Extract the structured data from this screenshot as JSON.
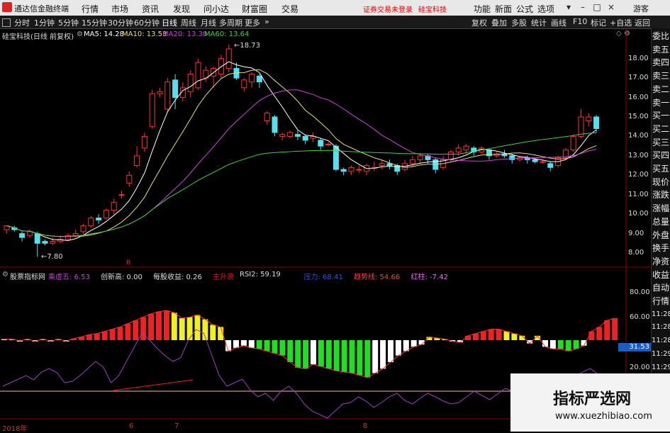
{
  "app": {
    "title": "通达信金融终端",
    "login_notice": "证券交易未登录",
    "stock_link": "硅宝科技"
  },
  "menu": [
    "行情",
    "市场",
    "资讯",
    "发现",
    "问小达",
    "财富圈",
    "交易"
  ],
  "menu_right": [
    "功能",
    "新面",
    "公式",
    "选项"
  ],
  "window_controls": {
    "guest": "游客"
  },
  "period_tabs": [
    "分时",
    "1分钟",
    "5分钟",
    "15分钟",
    "30分钟",
    "60分钟",
    "日线",
    "周线",
    "月线",
    "多周期",
    "更多"
  ],
  "active_tab": "日线",
  "toolbar_right": [
    "复权",
    "叠加",
    "多股",
    "统计",
    "画线",
    "F10",
    "标记",
    "+自选",
    "返回"
  ],
  "price_info": {
    "name": "硅宝科技(日线 前复权)",
    "ma5": "MA5: 14.28",
    "ma10": "MA10: 13.53",
    "ma20": "MA20: 13.30",
    "ma60": "MA60: 13.64",
    "high_label": "18.73",
    "low_label": "7.80",
    "b_mark": "B"
  },
  "y_ticks": [
    "18.00",
    "17.00",
    "16.00",
    "15.00",
    "14.00",
    "13.00",
    "12.00",
    "11.00",
    "10.00",
    "9.00",
    "8.00"
  ],
  "indicator": {
    "name": "股票指标网",
    "items": [
      {
        "label": "乘虚五:",
        "value": "6.53",
        "color": "#d03be0"
      },
      {
        "label": "创新高:",
        "value": "0.00",
        "color": "#dddddd"
      },
      {
        "label": "每股收益:",
        "value": "0.26",
        "color": "#dddddd"
      },
      {
        "label": "主升浪",
        "value": "",
        "color": "#e02020"
      },
      {
        "label": "RSI2:",
        "value": "59.19",
        "color": "#dddddd"
      },
      {
        "label": "压力:",
        "value": "68.41",
        "color": "#3050ff"
      },
      {
        "label": "趋势线:",
        "value": "54.66",
        "color": "#ff4040"
      },
      {
        "label": "红柱:",
        "value": "-7.42",
        "color": "#ff60ff"
      }
    ],
    "ticks": [
      "80.00",
      "60.00",
      "20.00"
    ],
    "current_value": "31.53"
  },
  "right_panel": [
    "委比",
    "卖五",
    "卖四",
    "卖三",
    "卖二",
    "卖一",
    "买一",
    "买二",
    "买三",
    "买四",
    "买五",
    "现价",
    "涨跌",
    "涨幅",
    "总量",
    "外盘",
    "换手",
    "净资",
    "收益",
    "自动",
    "行情",
    "11:28",
    "11:28",
    "11:28",
    "11:29",
    "11:29",
    "11:29",
    "11:29",
    "11:29"
  ],
  "x_labels": [
    "2018年",
    "6",
    "7",
    "8"
  ],
  "watermark": {
    "line1": "指标严选网",
    "line2": "www.xuezhibiao.com"
  },
  "chart_data": {
    "type": "candlestick",
    "series_ma": [
      "MA5",
      "MA10",
      "MA20",
      "MA60"
    ],
    "candles": [
      [
        9.2,
        9.4,
        9.0,
        9.3
      ],
      [
        9.3,
        9.2,
        9.1,
        9.4
      ],
      [
        9.0,
        8.8,
        8.6,
        9.1
      ],
      [
        8.9,
        9.1,
        8.8,
        9.2
      ],
      [
        9.0,
        8.5,
        7.8,
        9.1
      ],
      [
        8.6,
        8.5,
        8.4,
        8.7
      ],
      [
        8.5,
        8.6,
        8.4,
        8.8
      ],
      [
        8.6,
        8.7,
        8.5,
        8.9
      ],
      [
        8.7,
        8.9,
        8.6,
        9.0
      ],
      [
        8.9,
        9.0,
        8.8,
        9.2
      ],
      [
        9.1,
        9.4,
        9.0,
        9.5
      ],
      [
        9.4,
        9.8,
        9.3,
        9.9
      ],
      [
        9.8,
        9.7,
        9.5,
        10.0
      ],
      [
        9.8,
        10.2,
        9.7,
        10.3
      ],
      [
        10.2,
        10.6,
        10.0,
        10.8
      ],
      [
        11.0,
        11.0,
        10.8,
        11.2
      ],
      [
        11.6,
        12.0,
        11.4,
        12.2
      ],
      [
        12.5,
        13.0,
        12.4,
        13.5
      ],
      [
        13.4,
        14.0,
        13.2,
        14.2
      ],
      [
        14.5,
        16.2,
        14.4,
        16.4
      ],
      [
        16.2,
        16.3,
        16.0,
        16.5
      ],
      [
        15.4,
        16.8,
        15.2,
        17.0
      ],
      [
        16.9,
        16.0,
        15.4,
        17.2
      ],
      [
        16.0,
        16.5,
        15.8,
        16.8
      ],
      [
        16.3,
        17.2,
        16.0,
        17.4
      ],
      [
        16.5,
        17.8,
        16.4,
        18.0
      ],
      [
        17.0,
        17.4,
        16.8,
        17.6
      ],
      [
        17.1,
        17.5,
        16.5,
        17.6
      ],
      [
        17.2,
        18.0,
        17.0,
        18.2
      ],
      [
        17.5,
        18.5,
        17.3,
        18.73
      ],
      [
        17.5,
        17.0,
        16.9,
        17.8
      ],
      [
        16.5,
        16.9,
        16.3,
        17.0
      ],
      [
        16.8,
        17.2,
        16.5,
        17.3
      ],
      [
        17.1,
        16.8,
        16.5,
        17.2
      ],
      [
        14.8,
        15.2,
        14.6,
        15.3
      ],
      [
        15.0,
        14.2,
        14.0,
        15.1
      ],
      [
        14.0,
        14.1,
        13.8,
        14.2
      ],
      [
        14.0,
        14.2,
        13.9,
        14.3
      ],
      [
        14.1,
        14.0,
        13.8,
        14.3
      ],
      [
        14.0,
        13.8,
        13.6,
        14.1
      ],
      [
        13.9,
        14.0,
        13.7,
        14.2
      ],
      [
        13.8,
        13.5,
        13.3,
        13.9
      ],
      [
        13.6,
        13.6,
        13.5,
        13.7
      ],
      [
        13.5,
        12.3,
        12.2,
        13.6
      ],
      [
        12.3,
        12.2,
        12.0,
        12.4
      ],
      [
        12.2,
        12.4,
        12.0,
        12.5
      ],
      [
        12.3,
        12.3,
        12.1,
        12.5
      ],
      [
        12.2,
        12.5,
        12.0,
        12.6
      ],
      [
        12.4,
        12.4,
        12.2,
        12.7
      ],
      [
        12.5,
        12.6,
        12.3,
        12.8
      ],
      [
        12.6,
        12.5,
        12.3,
        12.8
      ],
      [
        12.5,
        12.2,
        12.0,
        12.6
      ],
      [
        12.3,
        12.6,
        12.2,
        12.8
      ],
      [
        12.6,
        12.8,
        12.4,
        13.0
      ],
      [
        12.8,
        13.0,
        12.6,
        13.1
      ],
      [
        13.0,
        12.8,
        12.6,
        13.1
      ],
      [
        12.8,
        12.3,
        12.1,
        12.9
      ],
      [
        12.4,
        12.8,
        12.3,
        13.0
      ],
      [
        12.8,
        13.2,
        12.7,
        13.3
      ],
      [
        13.2,
        13.4,
        13.0,
        13.6
      ],
      [
        13.3,
        13.5,
        13.1,
        13.6
      ],
      [
        13.4,
        13.2,
        13.0,
        13.5
      ],
      [
        13.2,
        13.4,
        13.1,
        13.5
      ],
      [
        13.3,
        13.0,
        12.8,
        13.4
      ],
      [
        13.0,
        13.1,
        12.9,
        13.2
      ],
      [
        13.1,
        13.0,
        12.9,
        13.3
      ],
      [
        13.0,
        12.8,
        12.6,
        13.1
      ],
      [
        12.8,
        12.9,
        12.7,
        13.0
      ],
      [
        12.9,
        12.8,
        12.6,
        13.0
      ],
      [
        12.8,
        12.7,
        12.6,
        12.9
      ],
      [
        12.7,
        12.7,
        12.6,
        12.8
      ],
      [
        12.6,
        12.4,
        12.2,
        12.7
      ],
      [
        12.5,
        12.9,
        12.4,
        13.0
      ],
      [
        12.9,
        13.3,
        12.8,
        13.4
      ],
      [
        13.3,
        14.0,
        13.2,
        14.1
      ],
      [
        14.0,
        15.0,
        13.9,
        15.4
      ],
      [
        14.8,
        15.0,
        14.5,
        15.2
      ],
      [
        15.0,
        14.4,
        14.2,
        15.1
      ]
    ],
    "ylim": [
      7.6,
      18.9
    ],
    "indicator_bars": [
      [
        1,
        "y"
      ],
      [
        1,
        "y"
      ],
      [
        0.6,
        "w"
      ],
      [
        1,
        "y"
      ],
      [
        1,
        "w"
      ],
      [
        1,
        "y"
      ],
      [
        1,
        "w"
      ],
      [
        1,
        "y"
      ],
      [
        1,
        "w"
      ],
      [
        1.5,
        "r"
      ],
      [
        3,
        "r"
      ],
      [
        5,
        "r"
      ],
      [
        6,
        "r"
      ],
      [
        8,
        "r"
      ],
      [
        10,
        "r"
      ],
      [
        12,
        "r"
      ],
      [
        15,
        "r"
      ],
      [
        18,
        "r"
      ],
      [
        21,
        "r"
      ],
      [
        24,
        "r"
      ],
      [
        26,
        "r"
      ],
      [
        27,
        "r"
      ],
      [
        25,
        "y"
      ],
      [
        20,
        "y"
      ],
      [
        21,
        "y"
      ],
      [
        23,
        "y"
      ],
      [
        19,
        "y"
      ],
      [
        14,
        "y"
      ],
      [
        12,
        "y"
      ],
      [
        10,
        "w"
      ],
      [
        7,
        "w"
      ],
      [
        5,
        "w"
      ],
      [
        7,
        "w"
      ],
      [
        8,
        "g"
      ],
      [
        10,
        "g"
      ],
      [
        12,
        "g"
      ],
      [
        14,
        "g"
      ],
      [
        20,
        "g"
      ],
      [
        25,
        "g"
      ],
      [
        26,
        "g"
      ],
      [
        22,
        "w"
      ],
      [
        24,
        "g"
      ],
      [
        26,
        "g"
      ],
      [
        28,
        "g"
      ],
      [
        29,
        "g"
      ],
      [
        30,
        "g"
      ],
      [
        32,
        "g"
      ],
      [
        34,
        "g"
      ],
      [
        30,
        "w"
      ],
      [
        26,
        "w"
      ],
      [
        20,
        "w"
      ],
      [
        14,
        "w"
      ],
      [
        10,
        "w"
      ],
      [
        6,
        "w"
      ],
      [
        4,
        "w"
      ],
      [
        3,
        "y"
      ],
      [
        2,
        "y"
      ],
      [
        1,
        "y"
      ],
      [
        1,
        "w"
      ],
      [
        2,
        "w"
      ],
      [
        4,
        "r"
      ],
      [
        6,
        "r"
      ],
      [
        8,
        "r"
      ],
      [
        10,
        "r"
      ],
      [
        10,
        "r"
      ],
      [
        8,
        "y"
      ],
      [
        6,
        "y"
      ],
      [
        4,
        "y"
      ],
      [
        3,
        "w"
      ],
      [
        4,
        "y"
      ],
      [
        6,
        "w"
      ],
      [
        8,
        "w"
      ],
      [
        8,
        "g"
      ],
      [
        10,
        "g"
      ],
      [
        8,
        "g"
      ],
      [
        5,
        "w"
      ],
      [
        8,
        "r"
      ],
      [
        12,
        "r"
      ],
      [
        18,
        "r"
      ],
      [
        20,
        "r"
      ]
    ]
  }
}
